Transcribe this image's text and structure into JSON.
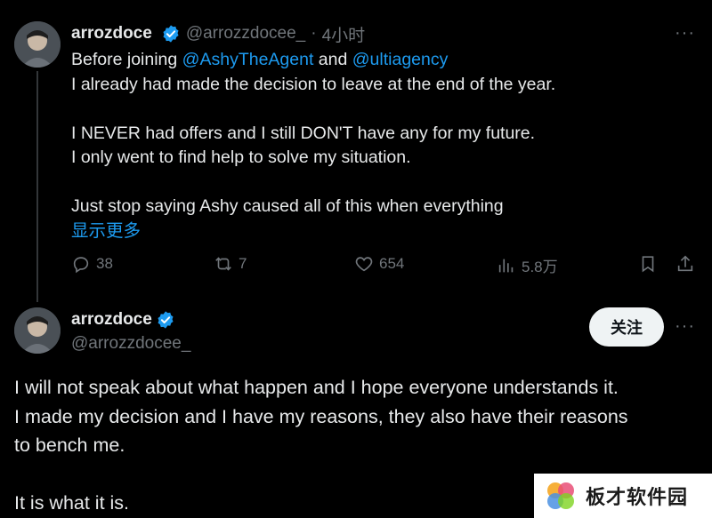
{
  "tweet1": {
    "author_name": "arrozdoce",
    "handle": "@arrozzdocee_",
    "separator": "·",
    "time": "4小时",
    "more": "···",
    "lines": [
      {
        "parts": [
          {
            "text": "Before joining ",
            "type": "text"
          },
          {
            "text": "@AshyTheAgent",
            "type": "mention"
          },
          {
            "text": " and ",
            "type": "text"
          },
          {
            "text": "@ultiagency",
            "type": "mention"
          }
        ]
      },
      {
        "text": "I already had made the decision to leave at the end of the year."
      },
      {
        "text": ""
      },
      {
        "text": "I NEVER had offers and I still DON'T have any for my future."
      },
      {
        "text": "I only went to find help to solve my situation."
      },
      {
        "text": ""
      },
      {
        "text": "Just stop saying Ashy caused all of this when everything"
      }
    ],
    "show_more": "显示更多",
    "actions": {
      "replies": "38",
      "retweets": "7",
      "likes": "654",
      "views": "5.8万"
    }
  },
  "tweet2": {
    "author_name": "arrozdoce",
    "handle": "@arrozzdocee_",
    "follow_label": "关注",
    "more": "···",
    "lines": [
      "I will not speak about what happen and I hope everyone understands it.",
      "I made my decision and I have my reasons, they also have their reasons",
      "to bench me.",
      "",
      "It is what it is."
    ]
  },
  "watermark": {
    "text": "板才软件园"
  },
  "colors": {
    "background": "#000000",
    "text": "#e7e9ea",
    "secondary": "#71767b",
    "link": "#1d9bf0",
    "verified": "#1d9bf0"
  }
}
